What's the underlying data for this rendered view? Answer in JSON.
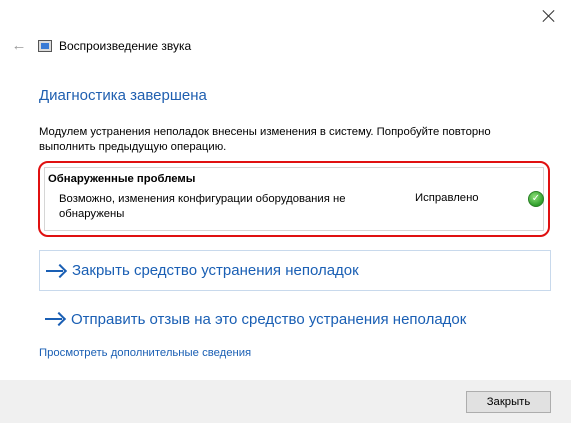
{
  "window": {
    "title": "Воспроизведение звука"
  },
  "main": {
    "heading": "Диагностика завершена",
    "description": "Модулем устранения неполадок внесены изменения в систему. Попробуйте повторно выполнить предыдущую операцию.",
    "problems": {
      "title": "Обнаруженные проблемы",
      "items": [
        {
          "text": "Возможно, изменения конфигурации оборудования не обнаружены",
          "status": "Исправлено",
          "status_icon": "check-icon",
          "status_color": "#2e9e2a"
        }
      ]
    },
    "actions": [
      {
        "label": "Закрыть средство устранения неполадок"
      },
      {
        "label": "Отправить отзыв на это средство устранения неполадок"
      }
    ],
    "more_link": "Просмотреть дополнительные сведения"
  },
  "footer": {
    "close_button": "Закрыть"
  },
  "colors": {
    "accent": "#1a5fb4",
    "highlight_border": "#e01010",
    "footer_bg": "#f0f0f0"
  }
}
